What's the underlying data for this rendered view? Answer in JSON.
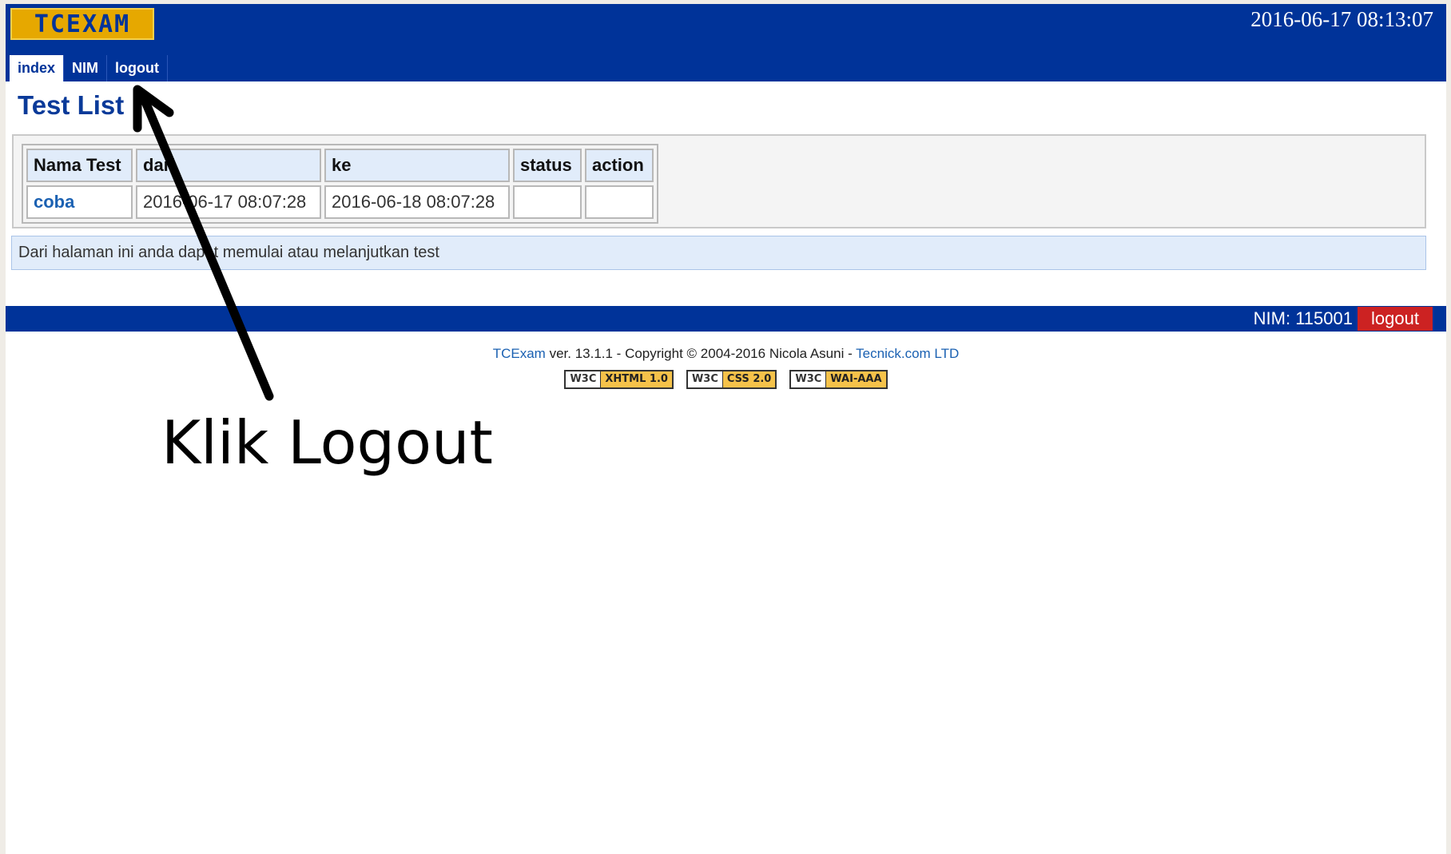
{
  "header": {
    "logo_text": "TCEXAM",
    "datetime": "2016-06-17 08:13:07",
    "menu": [
      {
        "label": "index",
        "active": true
      },
      {
        "label": "NIM",
        "active": false
      },
      {
        "label": "logout",
        "active": false
      }
    ]
  },
  "main": {
    "title": "Test List",
    "table": {
      "headers": [
        "Nama Test",
        "dari",
        "ke",
        "status",
        "action"
      ],
      "rows": [
        {
          "name": "coba",
          "from": "2016-06-17 08:07:28",
          "to": "2016-06-18 08:07:28",
          "status": "",
          "action": ""
        }
      ]
    },
    "info_text": "Dari halaman ini anda dapat memulai atau melanjutkan test"
  },
  "footer": {
    "nim": "NIM: 115001",
    "logout_label": "logout",
    "copyright": {
      "app_link": "TCExam",
      "text": " ver. 13.1.1 - Copyright © 2004-2016 Nicola Asuni - ",
      "company_link": "Tecnick.com LTD"
    },
    "badges": [
      {
        "org": "W3C",
        "spec": "XHTML 1.0"
      },
      {
        "org": "W3C",
        "spec": "CSS 2.0"
      },
      {
        "org": "W3C",
        "spec": "WAI-AAA"
      }
    ]
  },
  "annotation": {
    "text": "Klik Logout"
  },
  "colors": {
    "header_blue": "#003399",
    "logo_yellow": "#e6a800",
    "logout_red": "#cc2222",
    "link_blue": "#1b61b2",
    "info_bg": "#e1ecfa"
  }
}
